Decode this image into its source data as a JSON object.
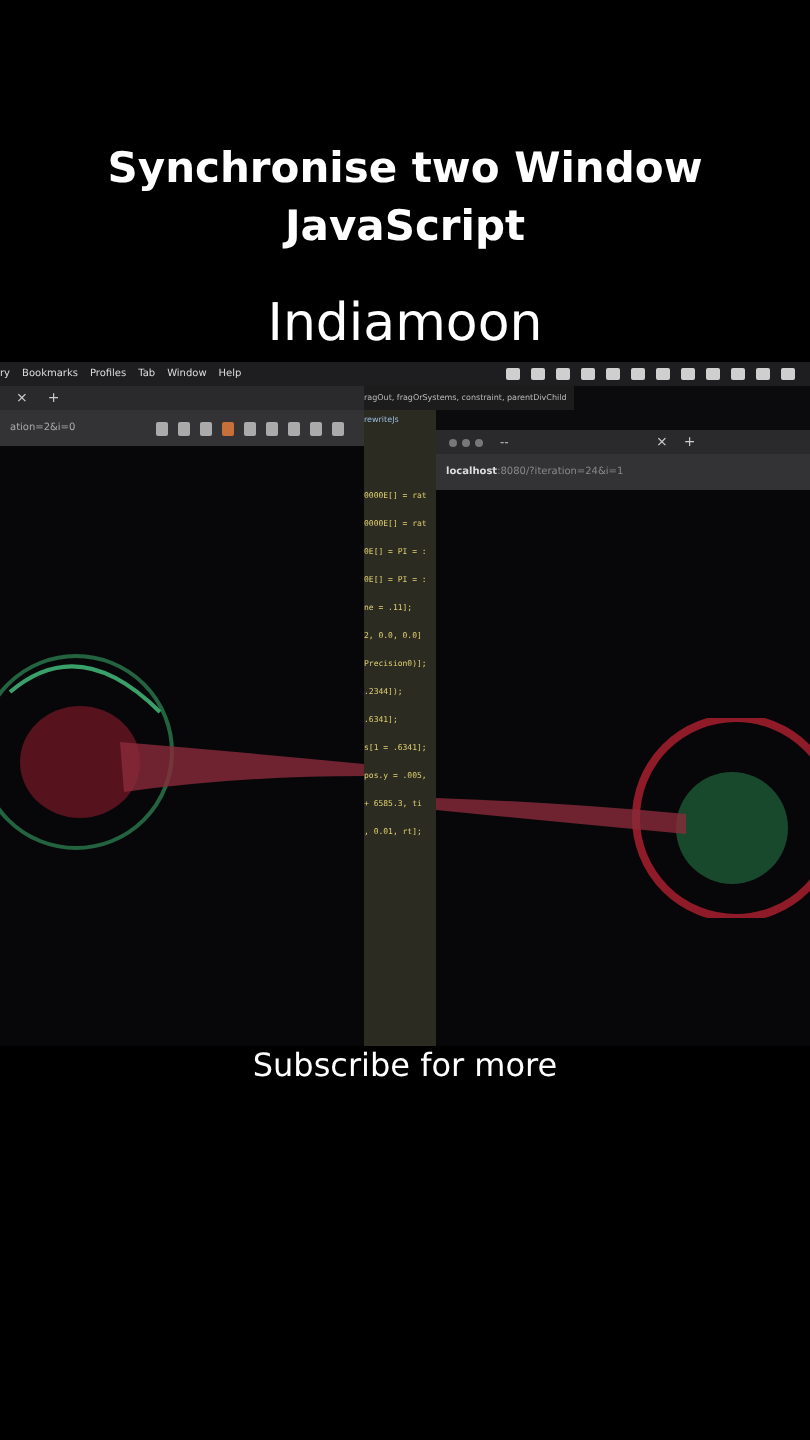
{
  "title": "Synchronise two Window JavaScript",
  "channel": "Indiamoon",
  "screen": {
    "menu_bar": [
      "ry",
      "Bookmarks",
      "Profiles",
      "Tab",
      "Window",
      "Help"
    ],
    "left_browser": {
      "tab_close": "×",
      "new_tab": "+",
      "url": "ation=2&i=0"
    },
    "editor": {
      "path": "ragOut, fragOrSystems, constraint, parentDivChild",
      "tab": "rewriteJs",
      "lines": [
        "0000E[] = rat",
        "0000E[] = rat",
        "0E[] = PI = :",
        "0E[] = PI = :",
        "ne = .11];",
        "2, 0.0, 0.0]",
        "Precision0)];",
        ".2344]);",
        ".6341];",
        "s[1 = .6341];",
        "pos.y = .005,",
        "+ 6585.3, ti",
        ", 0.01, rt];"
      ]
    },
    "right_browser": {
      "tab_title": "--",
      "tab_close": "×",
      "new_tab": "+",
      "url_host": "localhost",
      "url_rest": ":8080/?iteration=24&i=1"
    }
  },
  "caption": "Subscribe for more"
}
